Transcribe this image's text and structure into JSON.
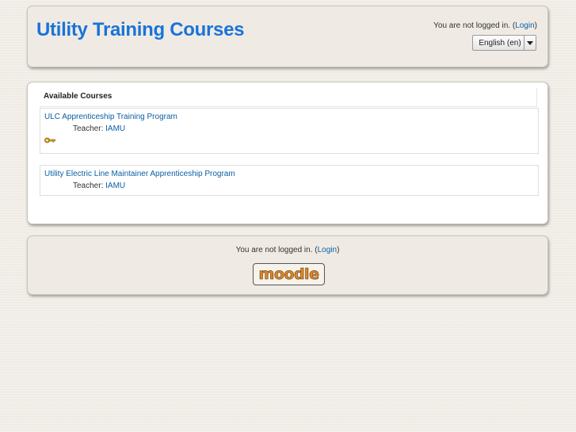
{
  "header": {
    "site_title": "Utility Training Courses",
    "login_prefix": "You are not logged in. (",
    "login_link": "Login",
    "login_suffix": ")",
    "language": "English (en)"
  },
  "main": {
    "section_title": "Available Courses",
    "courses": [
      {
        "name": "ULC Apprenticeship Training Program",
        "teacher_label": "Teacher:",
        "teacher": "IAMU",
        "guest_access": true
      },
      {
        "name": "Utility Electric Line Maintainer Apprenticeship Program",
        "teacher_label": "Teacher:",
        "teacher": "IAMU",
        "guest_access": false
      }
    ]
  },
  "footer": {
    "login_prefix": "You are not logged in. (",
    "login_link": "Login",
    "login_suffix": ")",
    "logo_text": "moodle"
  },
  "colors": {
    "title": "#1a73d8",
    "link": "#0b5fa5",
    "logo": "#e8841f"
  },
  "icons": {
    "guest": "key-icon",
    "dropdown": "chevron-down-icon"
  }
}
